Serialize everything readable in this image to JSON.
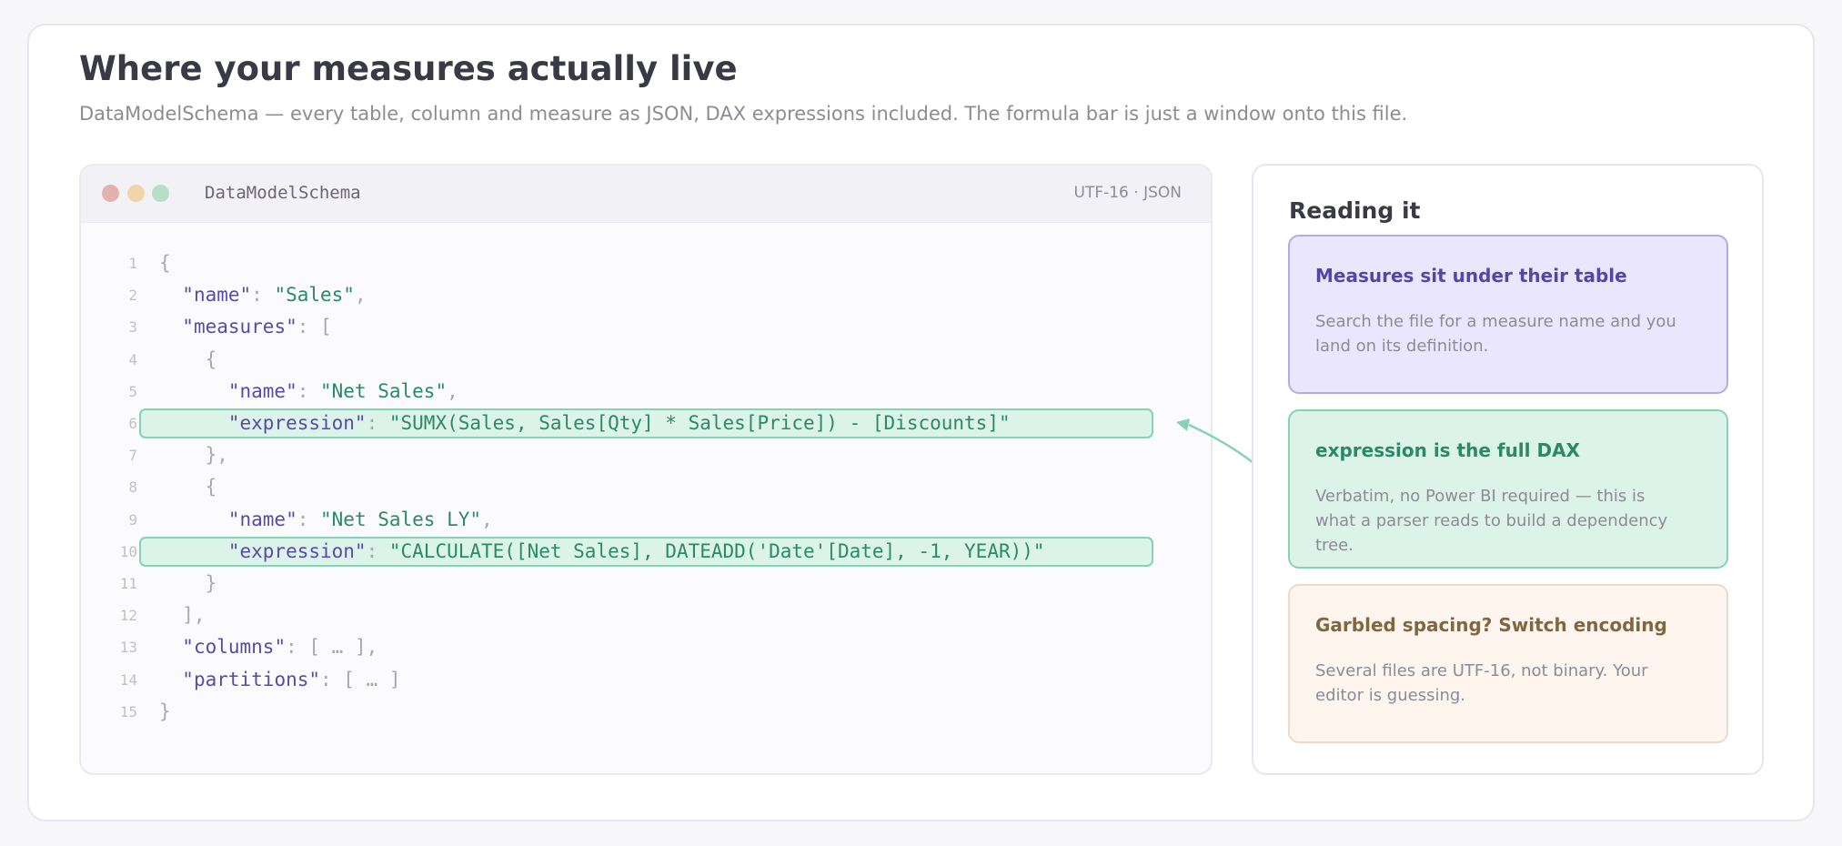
{
  "header": {
    "title": "Where your measures actually live",
    "subtitle": "DataModelSchema — every table, column and measure as JSON, DAX expressions included. The formula bar is just a window onto this file."
  },
  "editor": {
    "file_name": "DataModelSchema",
    "encoding": "UTF-16  ·  JSON",
    "lines": [
      {
        "num": "1",
        "tokens": [
          {
            "t": "{",
            "c": "punc"
          }
        ]
      },
      {
        "num": "2",
        "tokens": [
          {
            "t": "  ",
            "c": "punc"
          },
          {
            "t": "\"name\"",
            "c": "key"
          },
          {
            "t": ": ",
            "c": "punc"
          },
          {
            "t": "\"Sales\"",
            "c": "str"
          },
          {
            "t": ",",
            "c": "punc"
          }
        ]
      },
      {
        "num": "3",
        "tokens": [
          {
            "t": "  ",
            "c": "punc"
          },
          {
            "t": "\"measures\"",
            "c": "key"
          },
          {
            "t": ": [",
            "c": "punc"
          }
        ]
      },
      {
        "num": "4",
        "tokens": [
          {
            "t": "    {",
            "c": "punc"
          }
        ]
      },
      {
        "num": "5",
        "tokens": [
          {
            "t": "      ",
            "c": "punc"
          },
          {
            "t": "\"name\"",
            "c": "key"
          },
          {
            "t": ": ",
            "c": "punc"
          },
          {
            "t": "\"Net Sales\"",
            "c": "str"
          },
          {
            "t": ",",
            "c": "punc"
          }
        ]
      },
      {
        "num": "6",
        "highlight": true,
        "tokens": [
          {
            "t": "      ",
            "c": "punc"
          },
          {
            "t": "\"expression\"",
            "c": "key"
          },
          {
            "t": ": ",
            "c": "punc"
          },
          {
            "t": "\"SUMX(Sales, Sales[Qty] * Sales[Price]) - [Discounts]\"",
            "c": "str"
          }
        ]
      },
      {
        "num": "7",
        "tokens": [
          {
            "t": "    },",
            "c": "punc"
          }
        ]
      },
      {
        "num": "8",
        "tokens": [
          {
            "t": "    {",
            "c": "punc"
          }
        ]
      },
      {
        "num": "9",
        "tokens": [
          {
            "t": "      ",
            "c": "punc"
          },
          {
            "t": "\"name\"",
            "c": "key"
          },
          {
            "t": ": ",
            "c": "punc"
          },
          {
            "t": "\"Net Sales LY\"",
            "c": "str"
          },
          {
            "t": ",",
            "c": "punc"
          }
        ]
      },
      {
        "num": "10",
        "highlight": true,
        "tokens": [
          {
            "t": "      ",
            "c": "punc"
          },
          {
            "t": "\"expression\"",
            "c": "key"
          },
          {
            "t": ": ",
            "c": "punc"
          },
          {
            "t": "\"CALCULATE([Net Sales], DATEADD('Date'[Date], -1, YEAR))\"",
            "c": "str"
          }
        ]
      },
      {
        "num": "11",
        "tokens": [
          {
            "t": "    }",
            "c": "punc"
          }
        ]
      },
      {
        "num": "12",
        "tokens": [
          {
            "t": "  ],",
            "c": "punc"
          }
        ]
      },
      {
        "num": "13",
        "tokens": [
          {
            "t": "  ",
            "c": "punc"
          },
          {
            "t": "\"columns\"",
            "c": "key"
          },
          {
            "t": ": [ … ],",
            "c": "punc"
          }
        ]
      },
      {
        "num": "14",
        "tokens": [
          {
            "t": "  ",
            "c": "punc"
          },
          {
            "t": "\"partitions\"",
            "c": "key"
          },
          {
            "t": ": [ … ]",
            "c": "punc"
          }
        ]
      },
      {
        "num": "15",
        "tokens": [
          {
            "t": "}",
            "c": "punc"
          }
        ]
      }
    ]
  },
  "panel": {
    "title": "Reading it",
    "notes": [
      {
        "title": "Measures sit under their table",
        "body": "Search the file for a measure name and you land on its definition."
      },
      {
        "title": "expression is the full DAX",
        "body": "Verbatim, no Power BI required — this is what a parser reads to build a dependency tree."
      },
      {
        "title": "Garbled spacing? Switch encoding",
        "body": "Several files are UTF-16, not binary. Your editor is guessing."
      }
    ]
  },
  "colors": {
    "key": "#5a4aa8",
    "string": "#2a8a66",
    "punctuation": "#a8a8b2",
    "highlight_fill": "#dcf3ea",
    "highlight_border": "#86d2b4",
    "note_purple": "#eae6fd",
    "note_green": "#dcf3ea",
    "note_orange": "#fdf5ee"
  }
}
